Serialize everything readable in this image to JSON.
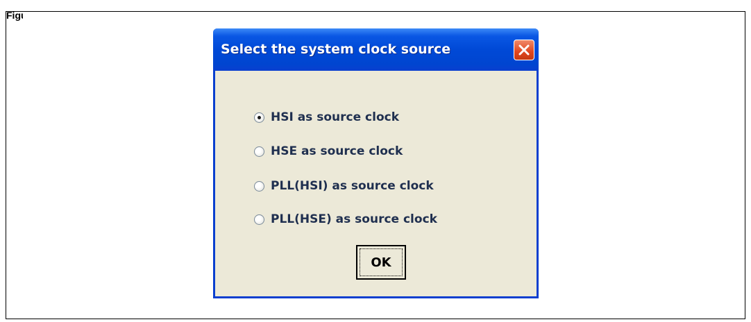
{
  "figure": {
    "label": "Figure"
  },
  "dialog": {
    "title": "Select the system clock source",
    "close_icon": "close-icon",
    "options": [
      {
        "label": "HSI as source clock",
        "checked": true
      },
      {
        "label": "HSE as source clock",
        "checked": false
      },
      {
        "label": "PLL(HSI) as source clock",
        "checked": false
      },
      {
        "label": "PLL(HSE) as source clock",
        "checked": false
      }
    ],
    "ok_label": "OK"
  },
  "colors": {
    "titlebar": "#0049d6",
    "dialog_bg": "#ece9d8",
    "close_button": "#e0461e",
    "label_text": "#1f2f4f"
  }
}
